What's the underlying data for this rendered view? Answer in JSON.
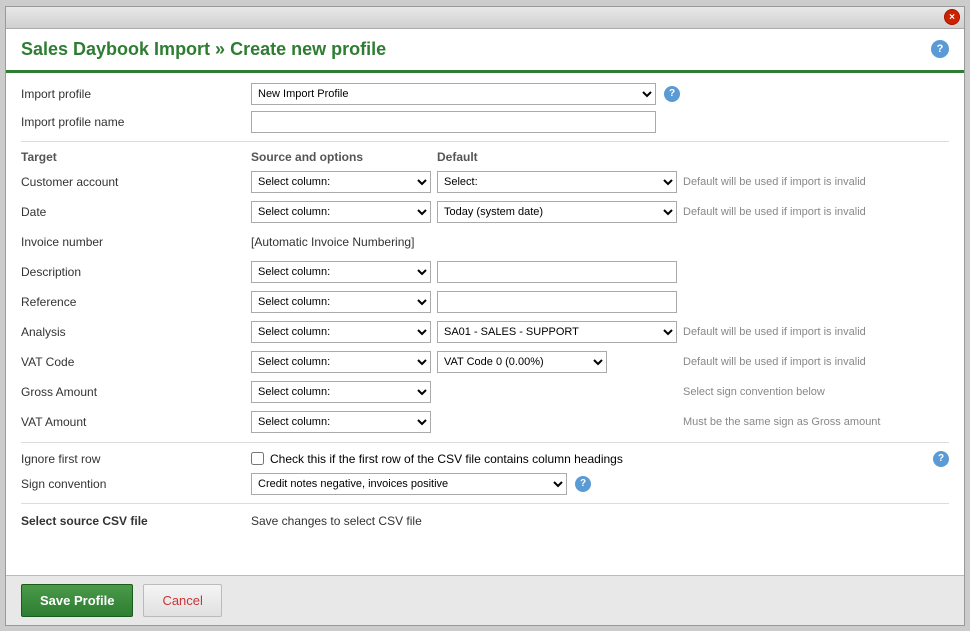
{
  "window": {
    "title": "Sales Daybook Import » Create new profile",
    "close_label": "×"
  },
  "header": {
    "title": "Sales Daybook Import » Create new profile",
    "help_label": "?"
  },
  "import_profile": {
    "label": "Import profile",
    "options": [
      "New Import Profile"
    ],
    "selected": "New Import Profile",
    "help_label": "?"
  },
  "import_profile_name": {
    "label": "Import profile name",
    "value": "",
    "placeholder": ""
  },
  "section_headers": {
    "target": "Target",
    "source_and_options": "Source and options",
    "default": "Default"
  },
  "fields": [
    {
      "label": "Customer account",
      "source_value": "Select column:",
      "default_value": "Select:",
      "note": "Default will be used if import is invalid"
    },
    {
      "label": "Date",
      "source_value": "Select column:",
      "default_value": "Today (system date)",
      "note": "Default will be used if import is invalid"
    },
    {
      "label": "Invoice number",
      "source_value": null,
      "default_value": "[Automatic Invoice Numbering]",
      "note": ""
    },
    {
      "label": "Description",
      "source_value": "Select column:",
      "default_value": "",
      "note": ""
    },
    {
      "label": "Reference",
      "source_value": "Select column:",
      "default_value": "",
      "note": ""
    },
    {
      "label": "Analysis",
      "source_value": "Select column:",
      "default_value": "SA01 - SALES - SUPPORT",
      "note": "Default will be used if import is invalid"
    },
    {
      "label": "VAT Code",
      "source_value": "Select column:",
      "default_value": "VAT Code 0 (0.00%)",
      "note": "Default will be used if import is invalid"
    },
    {
      "label": "Gross Amount",
      "source_value": "Select column:",
      "default_value": null,
      "note": "Select sign convention below"
    },
    {
      "label": "VAT Amount",
      "source_value": "Select column:",
      "default_value": null,
      "note": "Must be the same sign as Gross amount"
    }
  ],
  "ignore_first_row": {
    "label": "Ignore first row",
    "checkbox_text": "Check this if the first row of the CSV file contains column headings",
    "checked": false,
    "help_label": "?"
  },
  "sign_convention": {
    "label": "Sign convention",
    "options": [
      "Credit notes negative, invoices positive"
    ],
    "selected": "Credit notes negative, invoices positive",
    "help_label": "?"
  },
  "csv_file": {
    "label": "Select source CSV file",
    "value": "Save changes to select CSV file"
  },
  "footer": {
    "save_label": "Save Profile",
    "cancel_label": "Cancel"
  }
}
